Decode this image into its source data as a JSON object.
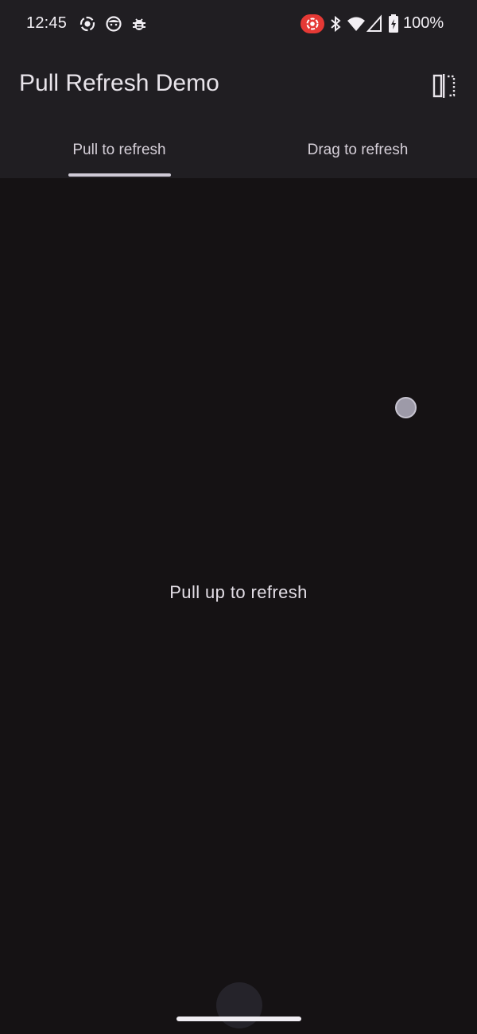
{
  "status_bar": {
    "time": "12:45",
    "battery": "100%",
    "icons": [
      "screen-record-icon",
      "face-icon",
      "bug-icon",
      "recording-indicator-icon",
      "bluetooth-icon",
      "wifi-icon",
      "cellular-signal-icon",
      "battery-charging-icon"
    ]
  },
  "app_bar": {
    "title": "Pull Refresh Demo",
    "action_icon": "split-screen-icon"
  },
  "tabs": [
    {
      "label": "Pull to refresh",
      "selected": true
    },
    {
      "label": "Drag to refresh",
      "selected": false
    }
  ],
  "content": {
    "hint": "Pull up to refresh"
  },
  "colors": {
    "background": "#151214",
    "top_bar": "#201e22",
    "recording_red": "#e53935",
    "indicator": "#cfcad6"
  }
}
